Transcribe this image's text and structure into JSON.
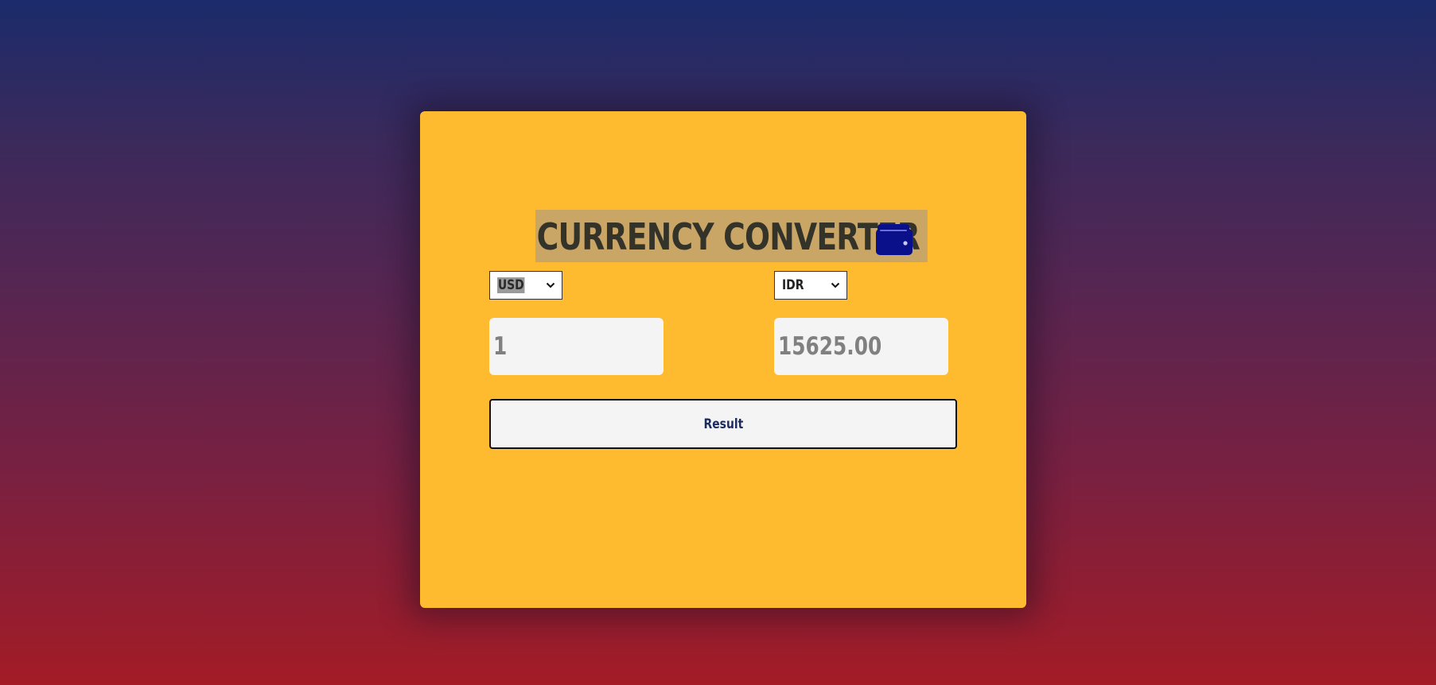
{
  "converter": {
    "title": "CURRENCY CONVERTER",
    "title_icon": "wallet-icon",
    "from_currency": "USD",
    "to_currency": "IDR",
    "from_amount": "1",
    "to_amount": "15625.00",
    "result_label": "Result"
  },
  "colors": {
    "card_background": "#ffbb2f",
    "title_highlight": "#c9a566",
    "wallet_icon": "#0a0f8a",
    "button_text": "#1b2b5e",
    "gradient_top": "#1b2b6b",
    "gradient_bottom": "#a31c26"
  }
}
